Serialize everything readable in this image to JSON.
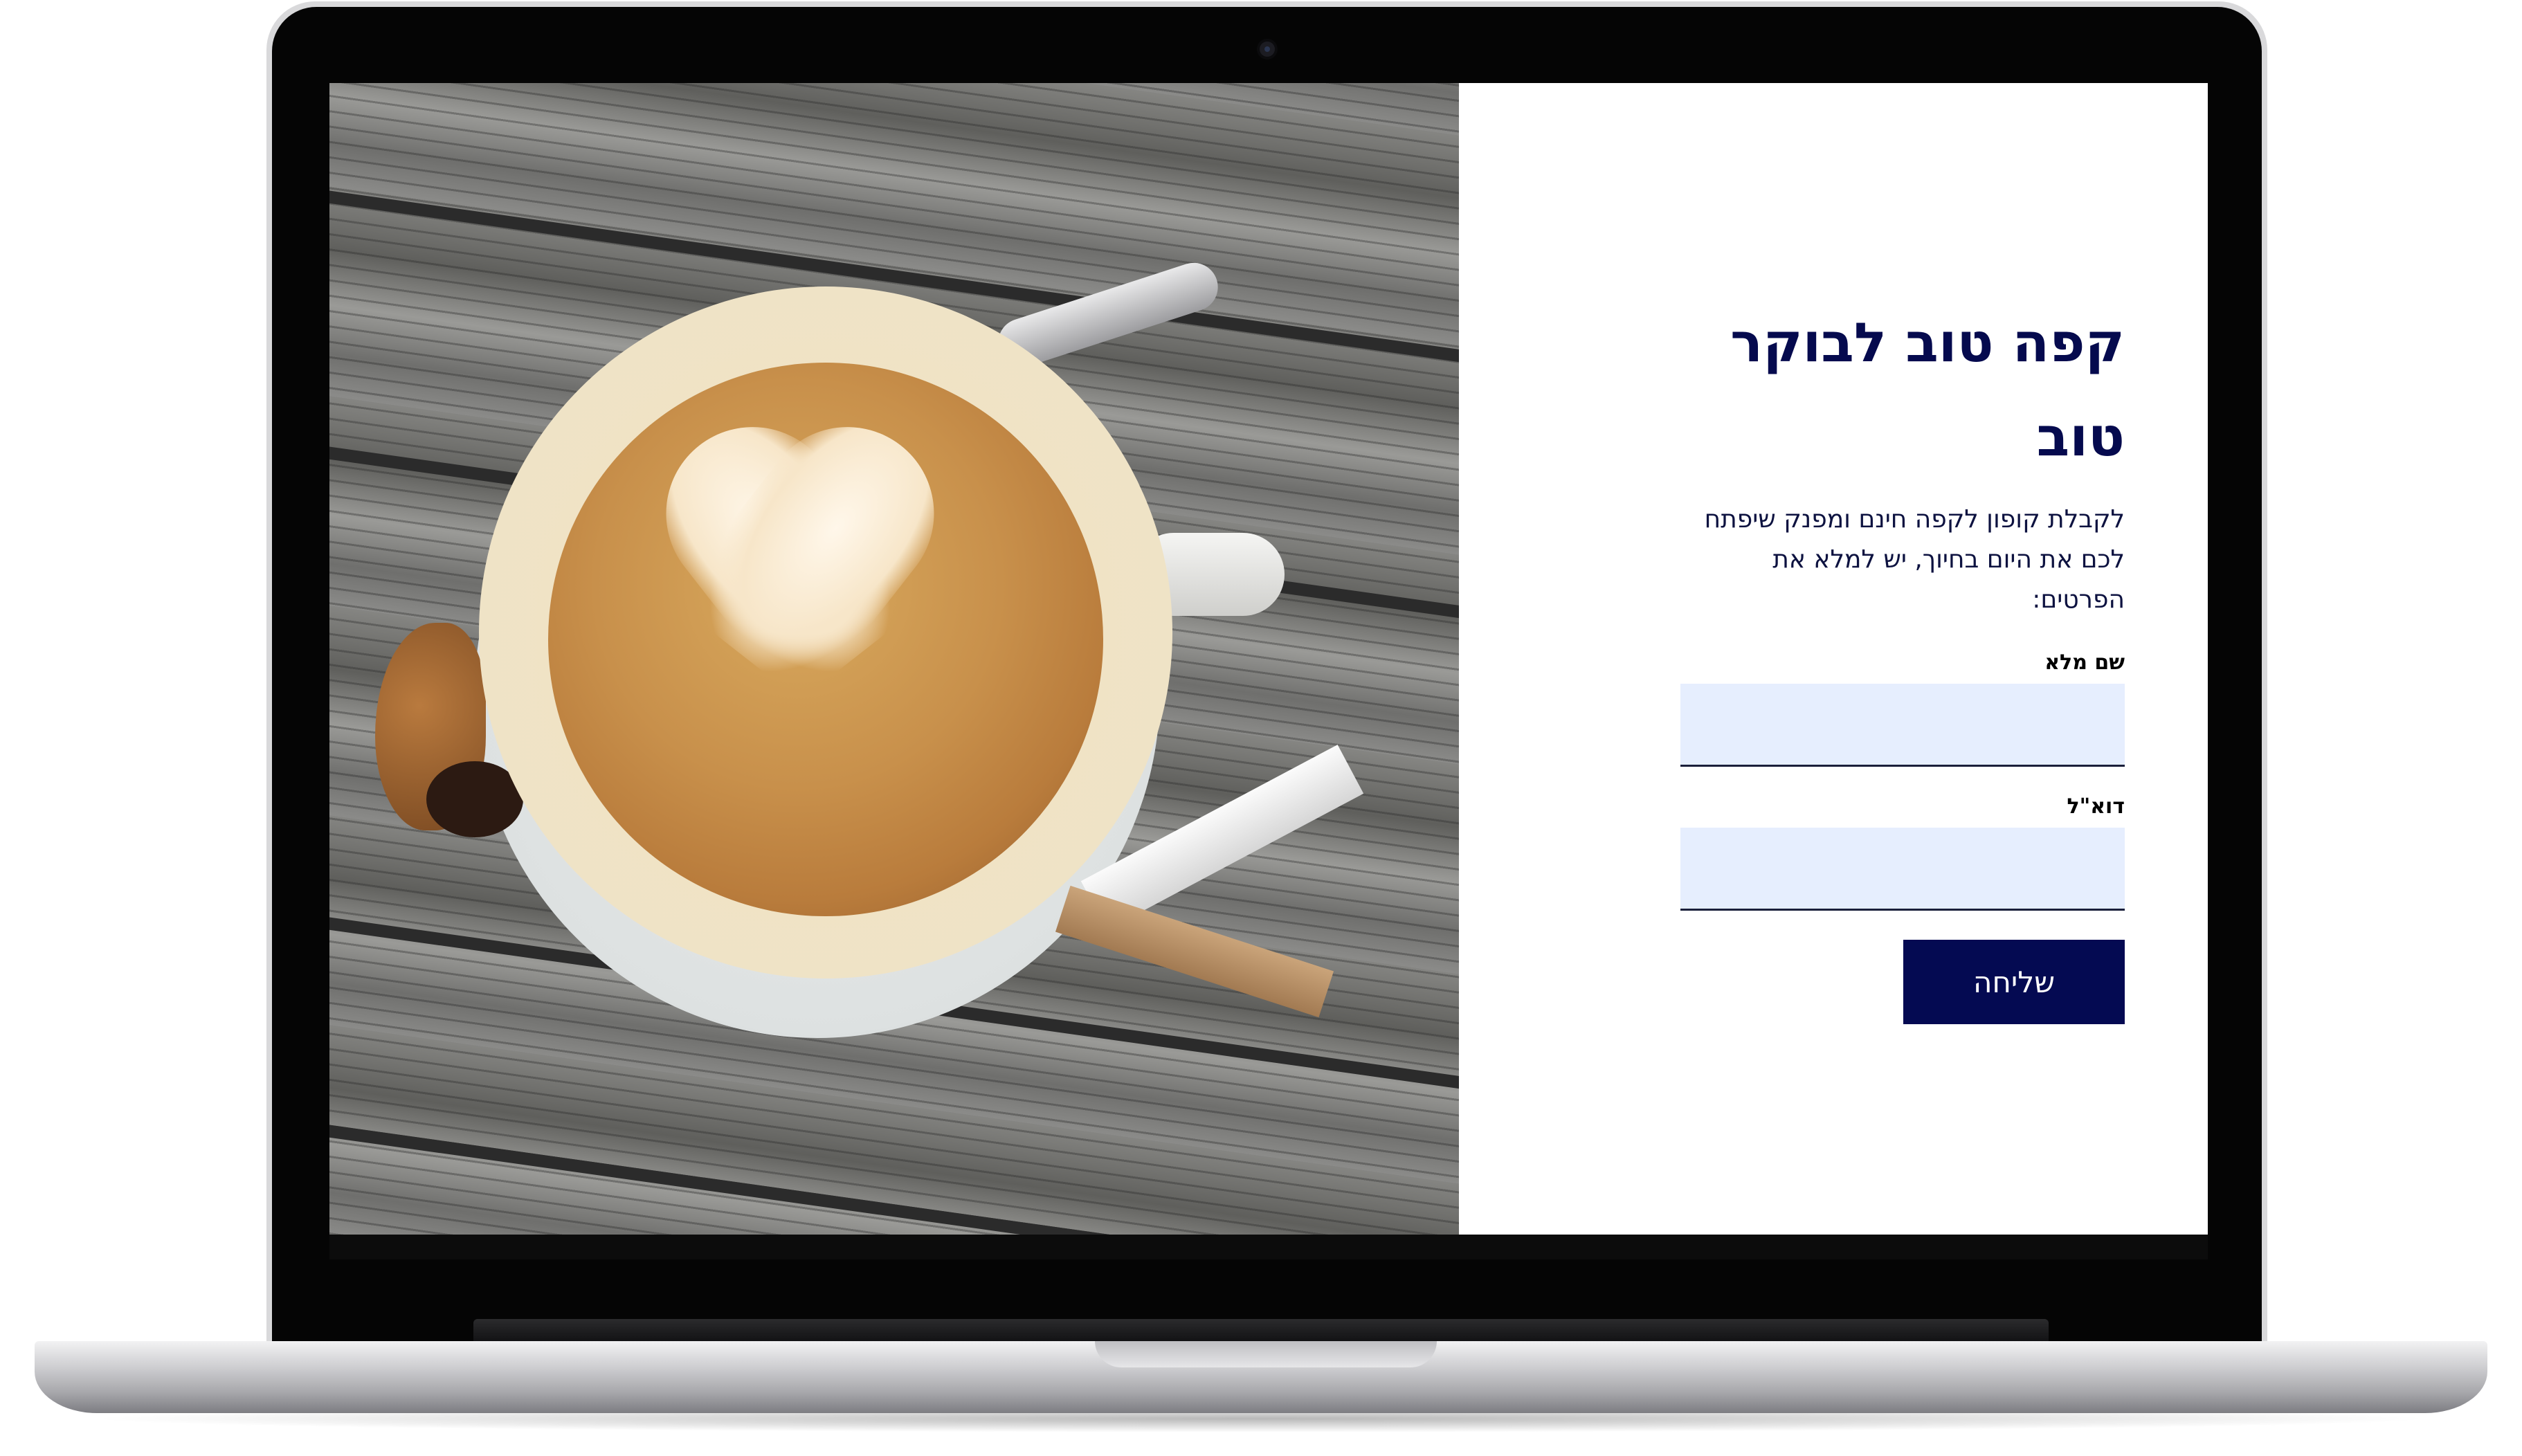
{
  "form": {
    "title": "קפה טוב לבוקר טוב",
    "subtitle": "לקבלת קופון לקפה חינם ומפנק שיפתח לכם את היום בחיוך, יש למלא את הפרטים:",
    "fields": [
      {
        "label": "שם מלא",
        "value": "",
        "placeholder": ""
      },
      {
        "label": "דוא\"ל",
        "value": "",
        "placeholder": ""
      }
    ],
    "submit_label": "שליחה"
  },
  "colors": {
    "heading": "#050a4e",
    "button_bg": "#040a52",
    "input_bg": "#e6eefe"
  },
  "image": {
    "subject": "latte-art-coffee-cup-on-wooden-table"
  }
}
